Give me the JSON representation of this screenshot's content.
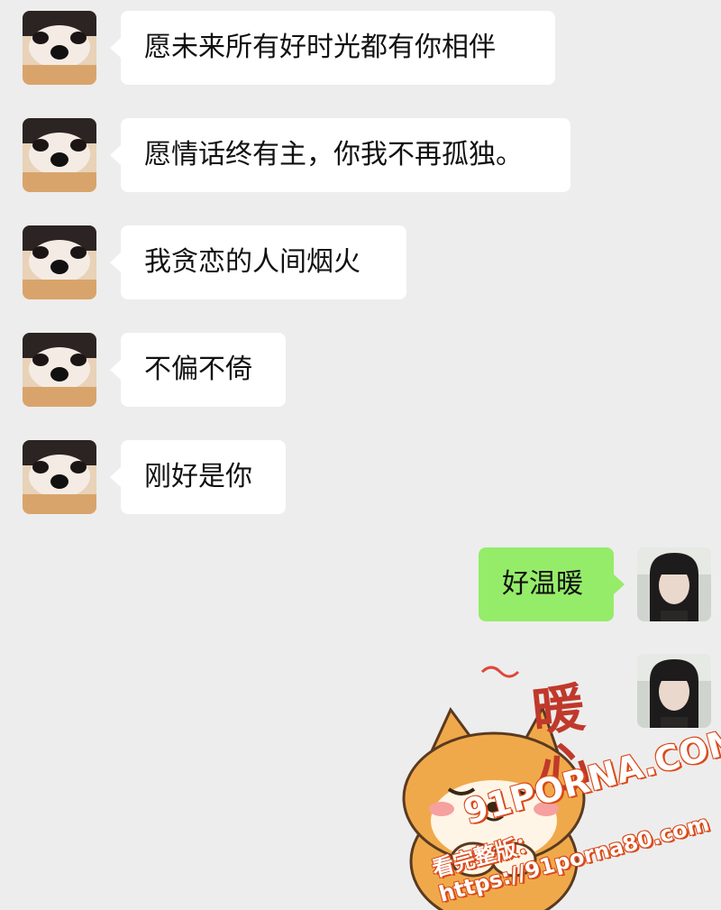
{
  "colors": {
    "background": "#ededed",
    "incoming_bubble": "#ffffff",
    "outgoing_bubble": "#95ec69"
  },
  "messages": [
    {
      "side": "in",
      "text": "愿未来所有好时光都有你相伴"
    },
    {
      "side": "in",
      "text": "愿情话终有主，你我不再孤独。"
    },
    {
      "side": "in",
      "text": "我贪恋的人间烟火"
    },
    {
      "side": "in",
      "text": "不偏不倚"
    },
    {
      "side": "in",
      "text": "刚好是你"
    },
    {
      "side": "out",
      "text": "好温暖"
    }
  ],
  "sticker": {
    "line1": "暖",
    "line2": "心",
    "icon": "shiba-dog-sticker"
  },
  "watermark": {
    "logo": "91PORNA.COM",
    "url": "看完整版：https://91porna80.com"
  },
  "avatars": {
    "contact_icon": "dog-avatar",
    "self_icon": "girl-avatar"
  }
}
